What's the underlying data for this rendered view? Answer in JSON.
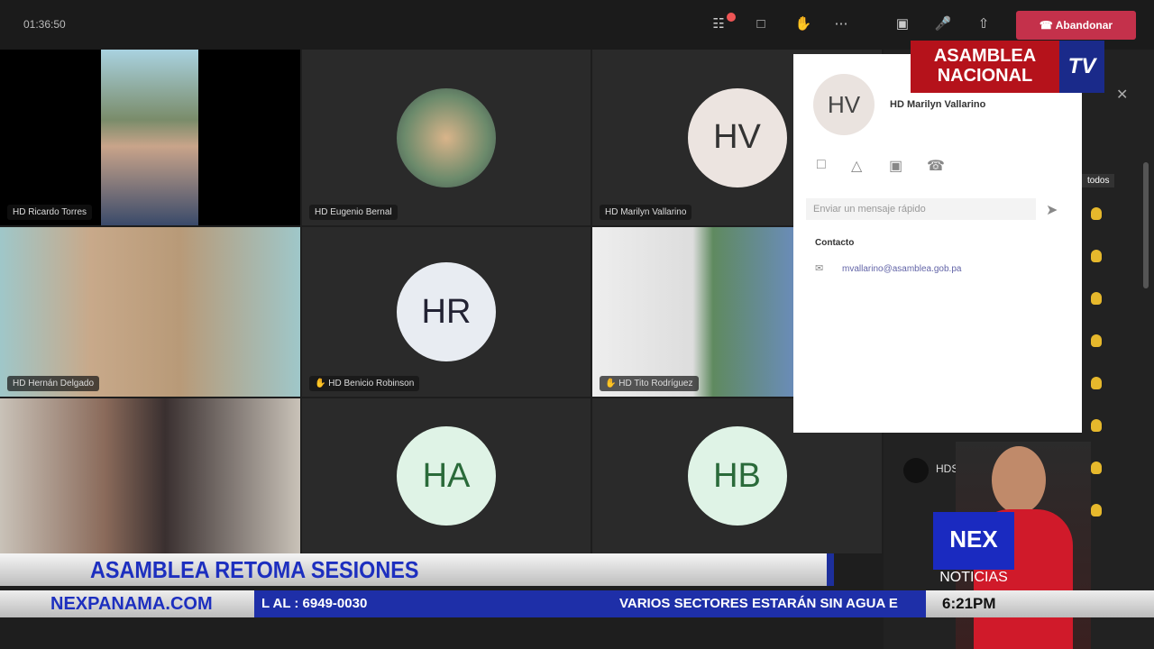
{
  "toolbar": {
    "timer": "01:36:50",
    "leave_label": "Abandonar",
    "icons": [
      "participants-icon",
      "chat-icon",
      "raise-hand-icon",
      "more-icon",
      "camera-icon",
      "mic-icon",
      "share-icon"
    ]
  },
  "tiles": [
    {
      "name": "HD Ricardo Torres",
      "type": "video"
    },
    {
      "name": "HD Eugenio Bernal",
      "type": "image"
    },
    {
      "name": "HD Marilyn Vallarino",
      "initials": "HV",
      "type": "avatar"
    },
    {
      "name": "HD Hernán Delgado",
      "type": "video"
    },
    {
      "name": "HD Benicio Robinson",
      "initials": "HR",
      "type": "avatar",
      "hand": true
    },
    {
      "name": "HD Tito Rodríguez",
      "type": "video",
      "hand": true
    },
    {
      "name": "",
      "type": "video"
    },
    {
      "name": "",
      "initials": "HA",
      "type": "avatar"
    },
    {
      "name": "",
      "initials": "HB",
      "type": "avatar"
    }
  ],
  "profile_card": {
    "initials": "HV",
    "name": "HD Marilyn Vallarino",
    "message_placeholder": "Enviar un mensaje rápido",
    "contact_label": "Contacto",
    "email": "mvallarino@asamblea.gob.pa"
  },
  "sidebar": {
    "button_label": "todos",
    "participant": "HDS Berta"
  },
  "logo": {
    "line1": "ASAMBLEA",
    "line2": "NACIONAL",
    "tv": "TV"
  },
  "broadcast": {
    "headline": "ASAMBLEA RETOMA SESIONES",
    "site": "NEXPANAMA.COM",
    "ticker_left": "L AL : 6949-0030",
    "ticker_right": "VARIOS SECTORES ESTARÁN SIN AGUA E",
    "time": "6:21PM",
    "brand": "NEX",
    "brand_sub": "NOTICIAS"
  }
}
